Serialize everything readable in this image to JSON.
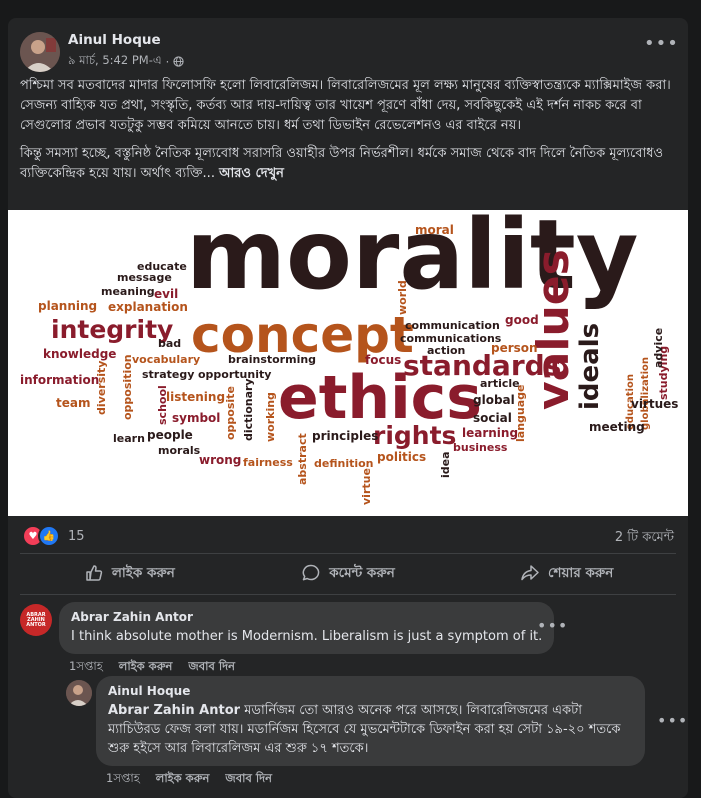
{
  "post": {
    "author": "Ainul Hoque",
    "date": "৯ মার্চ, 5:42 PM-এ",
    "visibility_icon": "globe-icon",
    "more_icon": "more-horizontal-icon",
    "paragraph1": "পশ্চিমা সব মতবাদের মাদার ফিলোসফি হলো লিবারেলিজম। লিবারেলিজমের মূল লক্ষ্য মানুষের ব্যক্তিস্বাতন্ত্র্যকে ম্যাক্সিমাইজ করা। সেজন্য বাহ্যিক যত প্রথা, সংস্কৃতি, কর্তব্য আর দায়-দায়িত্ব তার খায়েশ পূরণে বাঁধা দেয়, সবকিছুকেই এই দর্শন নাকচ করে বা সেগুলোর প্রভাব যতটুকু সম্ভব কমিয়ে আনতে চায়। ধর্ম তথা ডিভাইন রেভেলেশনও এর বাইরে নয়।",
    "paragraph2": "কিন্তু সমস্যা হচ্ছে, বস্তুনিষ্ঠ নৈতিক মূল্যবোধ সরাসরি ওয়াহীর উপর নির্ভরশীল। ধর্মকে সমাজ থেকে বাদ দিলে নৈতিক মূল্যবোধও ব্যক্তিকেন্দ্রিক হয়ে যায়। অর্থাৎ ব্যক্তি...",
    "see_more": "আরও দেখুন",
    "reaction_count": "15",
    "comment_count": "2 টি কমেন্ট",
    "actions": {
      "like": "লাইক করুন",
      "comment": "কমেন্ট করুন",
      "share": "শেয়ার করুন"
    }
  },
  "wordcloud": [
    {
      "text": "morality",
      "color": "#2a1a1a"
    },
    {
      "text": "concept",
      "color": "#b5541c"
    },
    {
      "text": "ethics",
      "color": "#8a1c2c"
    },
    {
      "text": "values",
      "color": "#8a1c2c"
    },
    {
      "text": "ideals",
      "color": "#2a1a1a"
    },
    {
      "text": "standards",
      "color": "#8a1c2c"
    },
    {
      "text": "integrity",
      "color": "#8a1c2c"
    },
    {
      "text": "rights",
      "color": "#8a1c2c"
    },
    {
      "text": "moral",
      "color": "#b5541c"
    },
    {
      "text": "educate",
      "color": "#2a1a1a"
    },
    {
      "text": "message",
      "color": "#2a1a1a"
    },
    {
      "text": "meaning",
      "color": "#2a1a1a"
    },
    {
      "text": "evil",
      "color": "#8a1c2c"
    },
    {
      "text": "planning",
      "color": "#b5541c"
    },
    {
      "text": "explanation",
      "color": "#b5541c"
    },
    {
      "text": "world",
      "color": "#b5541c"
    },
    {
      "text": "good",
      "color": "#8a1c2c"
    },
    {
      "text": "communication",
      "color": "#2a1a1a"
    },
    {
      "text": "communications",
      "color": "#2a1a1a"
    },
    {
      "text": "action",
      "color": "#2a1a1a"
    },
    {
      "text": "person",
      "color": "#b5541c"
    },
    {
      "text": "knowledge",
      "color": "#8a1c2c"
    },
    {
      "text": "bad",
      "color": "#2a1a1a"
    },
    {
      "text": "vocabulary",
      "color": "#b5541c"
    },
    {
      "text": "brainstorming",
      "color": "#2a1a1a"
    },
    {
      "text": "focus",
      "color": "#8a1c2c"
    },
    {
      "text": "information",
      "color": "#8a1c2c"
    },
    {
      "text": "diversity",
      "color": "#b5541c"
    },
    {
      "text": "strategy",
      "color": "#2a1a1a"
    },
    {
      "text": "opportunity",
      "color": "#2a1a1a"
    },
    {
      "text": "article",
      "color": "#2a1a1a"
    },
    {
      "text": "global",
      "color": "#2a1a1a"
    },
    {
      "text": "team",
      "color": "#b5541c"
    },
    {
      "text": "opposition",
      "color": "#b5541c"
    },
    {
      "text": "listening",
      "color": "#b5541c"
    },
    {
      "text": "school",
      "color": "#8a1c2c"
    },
    {
      "text": "opposite",
      "color": "#b5541c"
    },
    {
      "text": "symbol",
      "color": "#8a1c2c"
    },
    {
      "text": "dictionary",
      "color": "#2a1a1a"
    },
    {
      "text": "working",
      "color": "#b5541c"
    },
    {
      "text": "social",
      "color": "#2a1a1a"
    },
    {
      "text": "learning",
      "color": "#8a1c2c"
    },
    {
      "text": "language",
      "color": "#b5541c"
    },
    {
      "text": "learn",
      "color": "#2a1a1a"
    },
    {
      "text": "people",
      "color": "#2a1a1a"
    },
    {
      "text": "morals",
      "color": "#2a1a1a"
    },
    {
      "text": "principles",
      "color": "#2a1a1a"
    },
    {
      "text": "business",
      "color": "#8a1c2c"
    },
    {
      "text": "wrong",
      "color": "#8a1c2c"
    },
    {
      "text": "fairness",
      "color": "#b5541c"
    },
    {
      "text": "abstract",
      "color": "#b5541c"
    },
    {
      "text": "definition",
      "color": "#b5541c"
    },
    {
      "text": "politics",
      "color": "#b5541c"
    },
    {
      "text": "idea",
      "color": "#2a1a1a"
    },
    {
      "text": "virtue",
      "color": "#b5541c"
    },
    {
      "text": "education",
      "color": "#b5541c"
    },
    {
      "text": "globalization",
      "color": "#b5541c"
    },
    {
      "text": "studying",
      "color": "#8a1c2c"
    },
    {
      "text": "advice",
      "color": "#2a1a1a"
    },
    {
      "text": "virtues",
      "color": "#2a1a1a"
    },
    {
      "text": "meeting",
      "color": "#2a1a1a"
    }
  ],
  "comments": [
    {
      "author": "Abrar Zahin Antor",
      "avatar_text": "ABRAR ZAHIN ANTOR",
      "text": "I think absolute mother is Modernism. Liberalism is just a symptom of it.",
      "time": "1সপ্তাহ",
      "like": "লাইক করুন",
      "reply": "জবাব দিন"
    },
    {
      "author": "Ainul Hoque",
      "mention": "Abrar Zahin Antor",
      "text": " মডার্নিজম তো আরও অনেক পরে আসছে। লিবারেলিজমের একটা ম্যাচিউরড ফেজ বলা যায়। মডার্নিজম হিসেবে যে মুভমেন্টটাকে ডিফাইন করা হয় সেটা ১৯-২০ শতকে শুরু হইসে আর লিবারেলিজম এর শুরু ১৭ শতকে।",
      "time": "1সপ্তাহ",
      "like": "লাইক করুন",
      "reply": "জবাব দিন"
    }
  ]
}
